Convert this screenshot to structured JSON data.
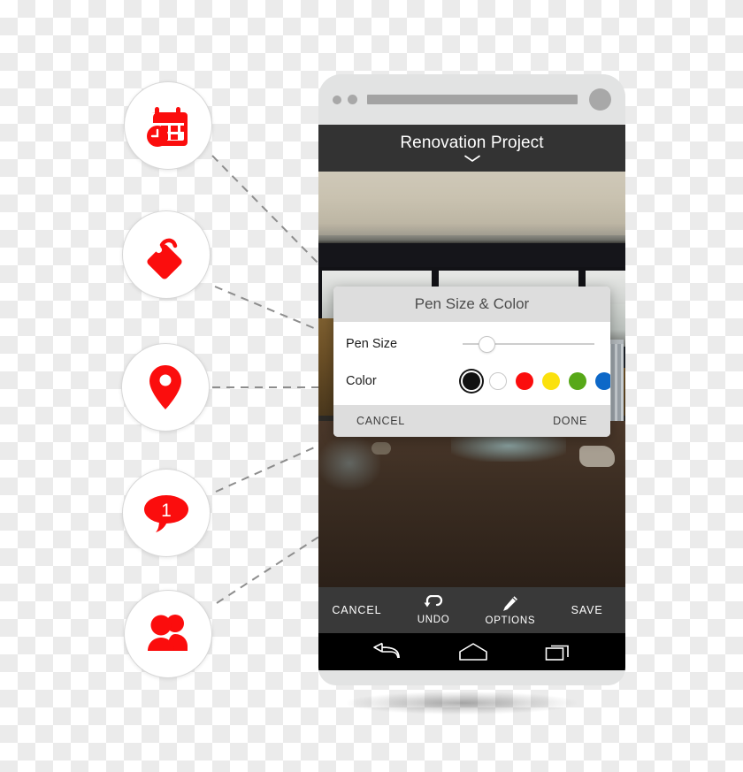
{
  "app": {
    "title": "Renovation Project",
    "expand_icon": "chevron-down-icon"
  },
  "photo": {
    "description": "Interior renovation damage photo with broken glass, radiator and dark door frame",
    "annotations": [
      {
        "shape": "ellipse",
        "color": "#f6401a",
        "name": "annotation-circle-top"
      },
      {
        "shape": "ellipse",
        "color": "#f6401a",
        "name": "annotation-circle-bottom"
      }
    ]
  },
  "dialog": {
    "title": "Pen Size & Color",
    "pen_size": {
      "label": "Pen Size",
      "value": 12,
      "min": 0,
      "max": 100
    },
    "color": {
      "label": "Color",
      "selected": "#111111",
      "swatches": [
        {
          "name": "swatch-black",
          "hex": "#111111",
          "selected": true
        },
        {
          "name": "swatch-white",
          "hex": "#ffffff",
          "selected": false
        },
        {
          "name": "swatch-red",
          "hex": "#fb0d0d",
          "selected": false
        },
        {
          "name": "swatch-yellow",
          "hex": "#fbe10d",
          "selected": false
        },
        {
          "name": "swatch-green",
          "hex": "#57a818",
          "selected": false
        },
        {
          "name": "swatch-blue",
          "hex": "#0d68c8",
          "selected": false
        }
      ]
    },
    "cancel_label": "CANCEL",
    "done_label": "DONE"
  },
  "action_bar": {
    "cancel_label": "CANCEL",
    "undo_label": "UNDO",
    "undo_icon": "undo-arrow-icon",
    "options_label": "OPTIONS",
    "options_icon": "pencil-icon",
    "save_label": "SAVE"
  },
  "nav_bar": {
    "back_icon": "back-arrow-icon",
    "home_icon": "home-icon",
    "recents_icon": "recent-apps-icon"
  },
  "feature_badges": [
    {
      "name": "badge-schedule",
      "icon": "calendar-clock-icon",
      "color": "#fb0d0d",
      "label": ""
    },
    {
      "name": "badge-tag",
      "icon": "price-tag-icon",
      "color": "#fb0d0d",
      "label": ""
    },
    {
      "name": "badge-location",
      "icon": "map-pin-icon",
      "color": "#fb0d0d",
      "label": ""
    },
    {
      "name": "badge-notification",
      "icon": "speech-bubble-icon",
      "color": "#fb0d0d",
      "label": "1"
    },
    {
      "name": "badge-team",
      "icon": "people-group-icon",
      "color": "#fb0d0d",
      "label": ""
    }
  ],
  "theme": {
    "accent_red": "#fb0d0d",
    "appbar_bg": "#333333",
    "phone_body": "#e2e3e3",
    "annotation_red": "#f6401a"
  }
}
